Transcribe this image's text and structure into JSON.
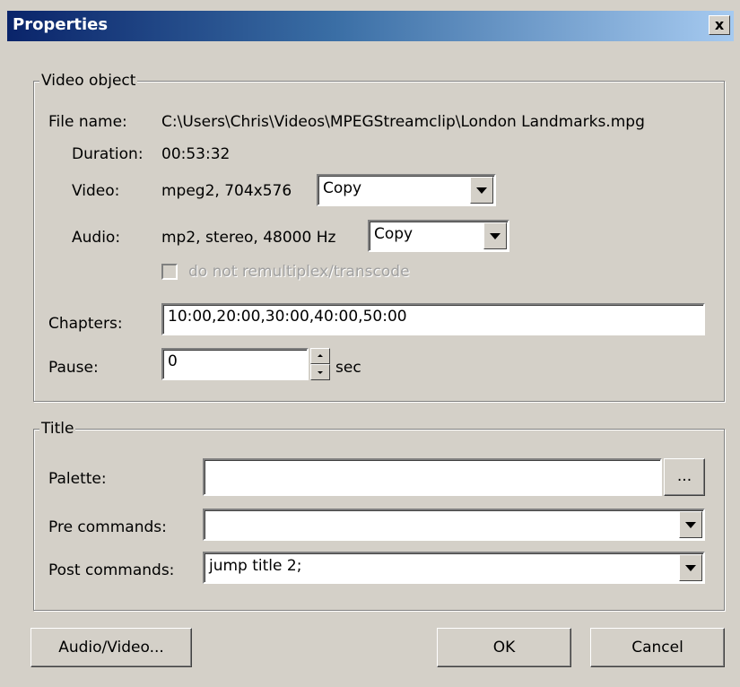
{
  "window": {
    "title": "Properties",
    "close_glyph": "x"
  },
  "video_object": {
    "legend": "Video object",
    "file_name_label": "File name:",
    "file_name_value": "C:\\Users\\Chris\\Videos\\MPEGStreamclip\\London Landmarks.mpg",
    "duration_label": "Duration:",
    "duration_value": "00:53:32",
    "video_label": "Video:",
    "video_info": "mpeg2, 704x576",
    "video_mode": "Copy",
    "audio_label": "Audio:",
    "audio_info": "mp2, stereo, 48000 Hz",
    "audio_mode": "Copy",
    "no_remux_label": "do not remultiplex/transcode",
    "no_remux_checked": false,
    "chapters_label": "Chapters:",
    "chapters_value": "10:00,20:00,30:00,40:00,50:00",
    "pause_label": "Pause:",
    "pause_value": "0",
    "pause_unit": "sec"
  },
  "title_group": {
    "legend": "Title",
    "palette_label": "Palette:",
    "palette_value": "",
    "palette_button": "...",
    "pre_label": "Pre commands:",
    "pre_value": "",
    "post_label": "Post commands:",
    "post_value": "jump title 2;"
  },
  "buttons": {
    "audio_video": "Audio/Video...",
    "ok": "OK",
    "cancel": "Cancel"
  },
  "icons": {
    "close": "close-icon",
    "dropdown": "chevron-down-icon",
    "spin_up": "spin-up-icon",
    "spin_down": "spin-down-icon"
  }
}
